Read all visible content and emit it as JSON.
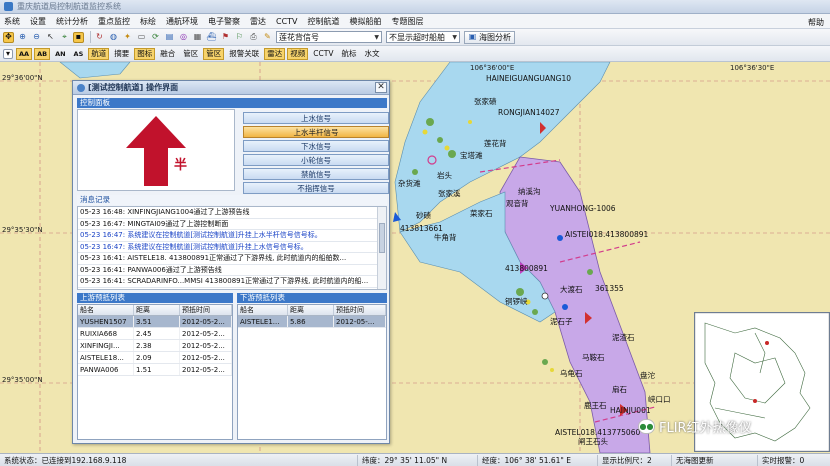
{
  "window": {
    "title": "重庆航道局控制航道监控系统"
  },
  "menu": {
    "items": [
      "系统",
      "设置",
      "统计分析",
      "重点监控",
      "标绘",
      "通航环境",
      "电子警察",
      "雷达",
      "CCTV",
      "控制航道",
      "模拟船舶",
      "专题图层"
    ],
    "help": "帮助"
  },
  "toolbar": {
    "station_select": "莲花背信号",
    "filter_select": "不显示超时船舶",
    "analysis_button": "海图分析"
  },
  "layer_toolbar": {
    "items": [
      {
        "label": "AA",
        "on": true,
        "small": true
      },
      {
        "label": "AB",
        "on": true,
        "small": true
      },
      {
        "label": "AN",
        "on": false,
        "small": true
      },
      {
        "label": "AS",
        "on": false,
        "small": true
      },
      {
        "label": "航道",
        "on": true
      },
      {
        "label": "摘要",
        "on": false
      },
      {
        "label": "图标",
        "on": true
      },
      {
        "label": "融合",
        "on": false
      },
      {
        "label": "管区",
        "on": false
      },
      {
        "label": "管区",
        "on": true
      },
      {
        "label": "报警关联",
        "on": false
      },
      {
        "label": "雷达",
        "on": true
      },
      {
        "label": "视频",
        "on": true
      },
      {
        "label": "CCTV",
        "on": false
      },
      {
        "label": "航标",
        "on": false
      },
      {
        "label": "水文",
        "on": false
      }
    ]
  },
  "map": {
    "lat_labels": [
      "29°36'00\"N",
      "29°35'30\"N",
      "29°35'00\"N"
    ],
    "lon_labels": [
      "106°36'00\"E",
      "106°36'30\"E"
    ],
    "ship_labels": [
      "HAINEIGUANGUANG10",
      "RONGJIAN14027",
      "YUANHONG-1006",
      "AISTEI018.413800891",
      "413800891",
      "413813661",
      "361355",
      "AISTEL018.413775060",
      "HAINJU001"
    ],
    "place_labels": [
      "莲花背",
      "纳溪沟",
      "张家碛",
      "杂货滩",
      "大渡石",
      "泥石子",
      "马鞍石",
      "峡口口",
      "铜锣峡",
      "乌龟石",
      "岩头",
      "鹿王石",
      "闸王石头",
      "观音背",
      "砂碛",
      "张家溪",
      "宝塔滩",
      "菜家石",
      "泥渣石",
      "牛角背",
      "盘沱",
      "扇石"
    ]
  },
  "dialog": {
    "title": "[测试控制航道] 操作界面",
    "control_label": "控制面板",
    "signal_char": "半",
    "signal_buttons": [
      {
        "label": "上水信号",
        "active": false
      },
      {
        "label": "上水半杆信号",
        "active": true
      },
      {
        "label": "下水信号",
        "active": false
      },
      {
        "label": "小轮信号",
        "active": false
      },
      {
        "label": "禁航信号",
        "active": false
      },
      {
        "label": "不指挥信号",
        "active": false
      }
    ],
    "message_label": "消息记录",
    "messages": [
      {
        "text": "05-23 16:48: XINFINGJIANG1004通过了上游预告线",
        "blue": false
      },
      {
        "text": "05-23 16:47: MINGTAI09通过了上游控制断面",
        "blue": false
      },
      {
        "text": "05-23 16:47: 系统建议在控制航道[测试控制航道]升挂上水半杆信号信号标。",
        "blue": true
      },
      {
        "text": "05-23 16:47: 系统建议在控制航道[测试控制航道]升挂上水信号信号标。",
        "blue": true
      },
      {
        "text": "05-23 16:41: AISTELE18. 413800891正常通过了下游界线, 此时航道内的船舶数...",
        "blue": false
      },
      {
        "text": "05-23 16:41: PANWA006通过了上游预告线",
        "blue": false
      },
      {
        "text": "05-23 16:41: SCRADARINFO...MMSI 413800891正常通过了下游界线, 此时航道内的船...",
        "blue": false
      }
    ],
    "upstream": {
      "label": "上游预抵列表",
      "columns": [
        "船名",
        "距离",
        "预抵时间"
      ],
      "rows": [
        [
          "YUSHEN1507",
          "3.51",
          "2012-05-2..."
        ],
        [
          "RUIXIA668",
          "2.45",
          "2012-05-2..."
        ],
        [
          "XINFINGJI...",
          "2.38",
          "2012-05-2..."
        ],
        [
          "AISTELE18...",
          "2.09",
          "2012-05-2..."
        ],
        [
          "PANWA006",
          "1.51",
          "2012-05-2..."
        ]
      ]
    },
    "downstream": {
      "label": "下游预抵列表",
      "columns": [
        "船名",
        "距离",
        "预抵时间"
      ],
      "rows": [
        [
          "AISTELE1...",
          "5.86",
          "2012-05-..."
        ]
      ]
    }
  },
  "status": {
    "connection": "系统状态：已连接到192.168.9.118",
    "latitude": "纬度：29° 35' 11.05\" N",
    "longitude": "经度：106° 38' 51.61\" E",
    "scale": "显示比例尺：2",
    "update": "无海图更新",
    "realtime": "实时报警：0"
  },
  "watermark": "FLIR红外热像仪",
  "colors": {
    "land": "#f0e6b0",
    "river": "#a8d8ef",
    "control_zone": "#c8a8e8",
    "signal_arrow": "#c1122c",
    "dialog_accent": "#3c78c8",
    "active_button": "#f1b544"
  }
}
